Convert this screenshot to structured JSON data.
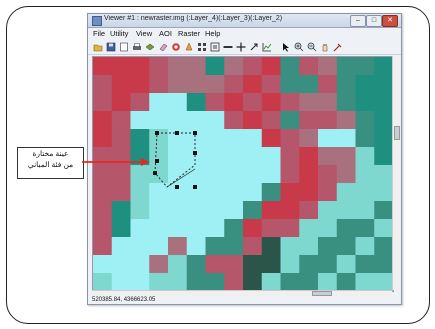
{
  "window": {
    "title": "Viewer #1 : newraster.img (:Layer_4)(:Layer_3)(:Layer_2)",
    "minimize": "–",
    "maximize": "□",
    "close": "✕"
  },
  "menu": [
    "File",
    "Utility",
    "View",
    "AOI",
    "Raster",
    "Help"
  ],
  "toolbar": {
    "icons": [
      "open-icon",
      "save-icon",
      "clear-icon",
      "print-icon",
      "layer-icon",
      "eraser-icon",
      "target-icon",
      "info-icon",
      "fit-icon",
      "rescale-icon",
      "measure-icon",
      "cross-icon",
      "draw-icon",
      "graph-icon",
      "pointer-icon",
      "zoom-in-icon",
      "zoom-out-icon",
      "pan-icon",
      "pick-icon"
    ]
  },
  "status": {
    "coordinates": "520385.84, 4366623.05"
  },
  "annotation": {
    "line1": "عينة مختارة",
    "line2": "من فئة المباني"
  },
  "colors": {
    "arrow": "#e3281e",
    "roi": "#1b1b1b"
  },
  "raster_grid": [
    "RRRMPPCPMRGMPGGC",
    "MRRMPPPMRMGGMGCC",
    "MRMLLCMRMRMPPGCC",
    "RMLLLLLMRMGMMPGC",
    "RMCTLLLLLRMPLLGC",
    "MMCTLLLLLLMRPPTC",
    "MMTTLLLLLLMRMPTT",
    "MMTLLLLLLGRRMTTT",
    "MCTLLLLLGRRMTTTG",
    "MCLLLLLGRMMTTGGT",
    "MLLLPLGGMDTTGGTG",
    "LLLPTGMMDDTGGTGG",
    "TLLTTGGMDTGGTGTT"
  ],
  "raster_palette": {
    "R": "#c83a4a",
    "M": "#b5566b",
    "P": "#a9707e",
    "C": "#1f8f80",
    "G": "#3a9080",
    "L": "#9ef0f4",
    "T": "#7fd8cf",
    "D": "#2a5548"
  }
}
